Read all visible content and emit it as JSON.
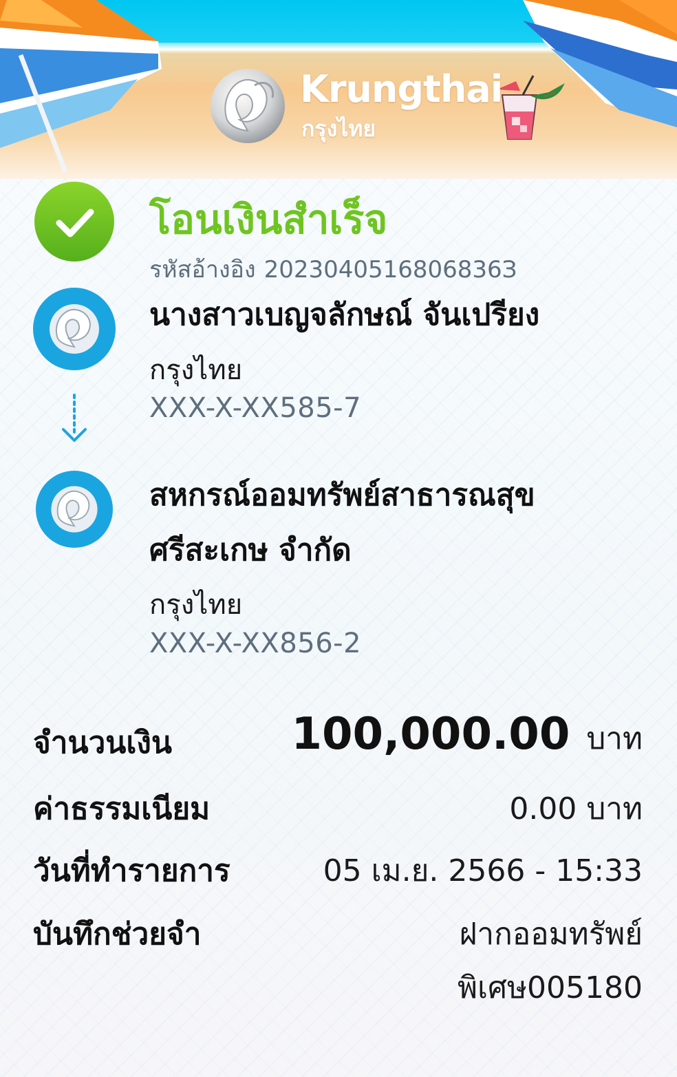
{
  "header": {
    "brand_en": "Krungthai",
    "brand_th": "กรุงไทย"
  },
  "status": {
    "title": "โอนเงินสำเร็จ",
    "ref_label": "รหัสอ้างอิง",
    "ref_code": "2023040516806836З",
    "icon": "check-icon",
    "color": "#6fc421"
  },
  "sender": {
    "name": "นางสาวเบญจลักษณ์ จันเปรียง",
    "bank": "กรุงไทย",
    "account": "XXX-X-XX585-7"
  },
  "receiver": {
    "name_line1": "สหกรณ์ออมทรัพย์สาธารณสุข",
    "name_line2": "ศรีสะเกษ จำกัด",
    "bank": "กรุงไทย",
    "account": "XXX-X-XX856-2"
  },
  "details": {
    "amount_label": "จำนวนเงิน",
    "amount_value": "100,000.00",
    "amount_unit": "บาท",
    "fee_label": "ค่าธรรมเนียม",
    "fee_value": "0.00 บาท",
    "date_label": "วันที่ทำรายการ",
    "date_value": "05 เม.ย. 2566 - 15:33",
    "memo_label": "บันทึกช่วยจำ",
    "memo_line1": "ฝากออมทรัพย์",
    "memo_line2": "พิเศษ005180"
  },
  "colors": {
    "accent_green": "#6fc421",
    "bank_blue": "#1ba5e0",
    "secondary_text": "#5e6e7d"
  }
}
